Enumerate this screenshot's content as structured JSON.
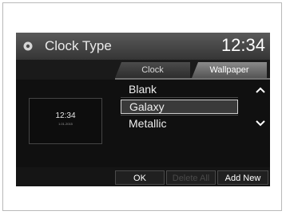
{
  "header": {
    "title": "Clock Type",
    "time": "12:34",
    "icon": "gear-icon"
  },
  "tabs": [
    {
      "label": "Clock",
      "active": false
    },
    {
      "label": "Wallpaper",
      "active": true
    }
  ],
  "preview": {
    "time": "12:34",
    "date": "1.01.2015"
  },
  "list": {
    "items": [
      {
        "label": "Blank",
        "selected": false
      },
      {
        "label": "Galaxy",
        "selected": true
      },
      {
        "label": "Metallic",
        "selected": false
      }
    ],
    "up_icon": "chevron-up-icon",
    "down_icon": "chevron-down-icon"
  },
  "buttons": {
    "ok": "OK",
    "delete_all": "Delete All",
    "add_new": "Add New"
  },
  "colors": {
    "disabled_text": "#4a4a4a",
    "text": "#ffffff"
  }
}
